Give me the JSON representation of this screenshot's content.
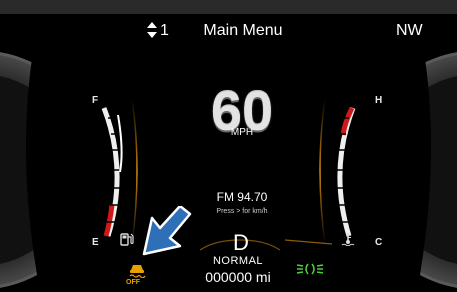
{
  "top_bar": {
    "display_number": "1",
    "title": "Main Menu",
    "compass": "NW"
  },
  "speed": {
    "value": "60",
    "unit": "MPH"
  },
  "radio": {
    "station": "FM 94.70",
    "hint": "Press > for km/h"
  },
  "drive": {
    "gear": "D",
    "mode": "NORMAL",
    "odometer": "000000 mi"
  },
  "fuel_gauge": {
    "full_label": "F",
    "empty_label": "E",
    "icon": "fuel-pump-icon"
  },
  "temp_gauge": {
    "hot_label": "H",
    "cold_label": "C",
    "icon": "coolant-temperature-icon"
  },
  "indicators": {
    "traction_off_label": "OFF",
    "traction_off_icon": "traction-control-off-icon",
    "traction_off_color": "#e8a000",
    "parking_lights_icon": "parking-lights-icon",
    "parking_lights_color": "#4cd137",
    "callout_arrow_icon": "callout-arrow-icon",
    "callout_arrow_color": "#2f6fb7"
  },
  "colors": {
    "background": "#000000",
    "accent_amber": "#c8820c",
    "gauge_warning_red": "#d01818"
  }
}
